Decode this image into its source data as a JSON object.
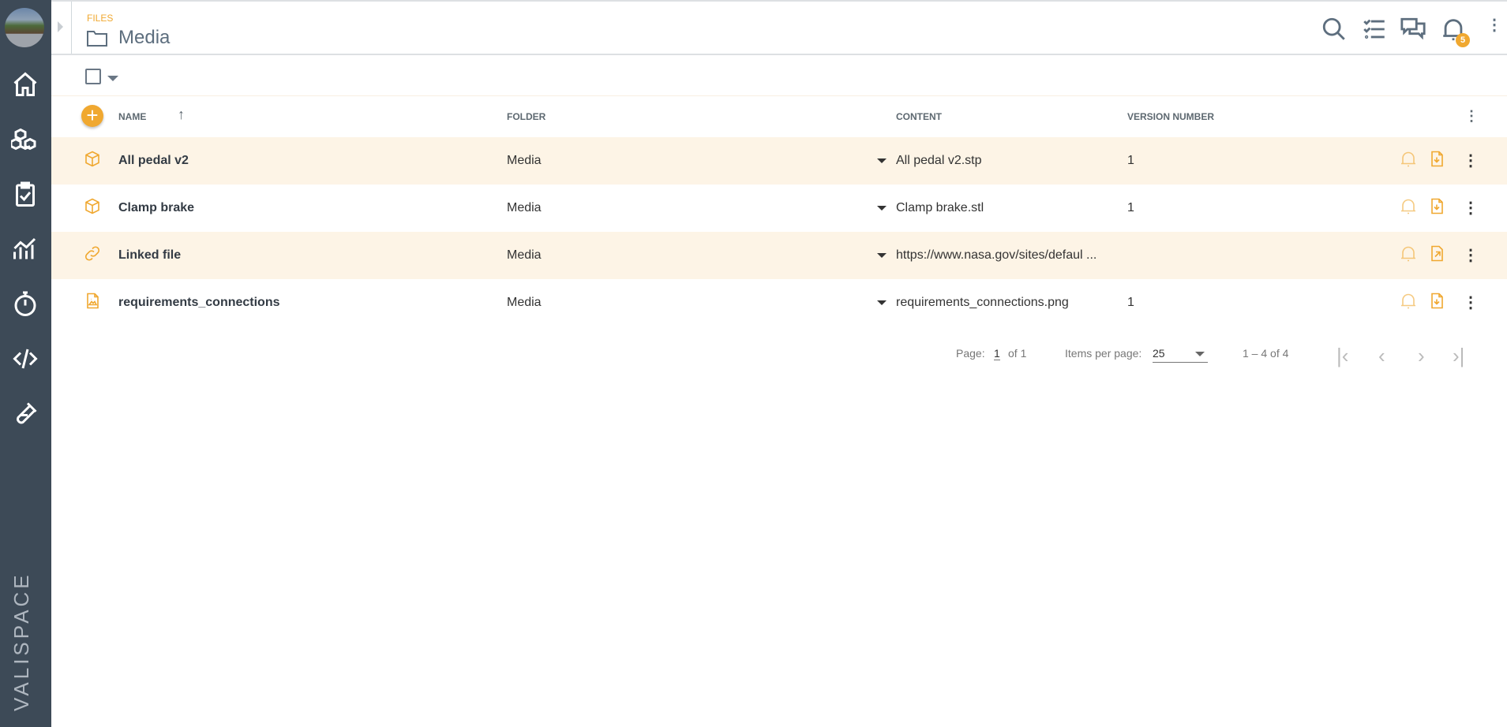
{
  "sidebar": {
    "brand": "VALISPACE",
    "items": [
      "home-icon",
      "components-icon",
      "requirements-icon",
      "analyses-icon",
      "timer-icon",
      "scripting-icon",
      "test-icon"
    ]
  },
  "header": {
    "breadcrumb": "FILES",
    "title": "Media",
    "notification_count": "5"
  },
  "table": {
    "columns": {
      "name": "NAME",
      "folder": "FOLDER",
      "content": "CONTENT",
      "version": "VERSION NUMBER"
    },
    "rows": [
      {
        "name": "All pedal v2",
        "folder": "Media",
        "content": "All pedal v2.stp",
        "version": "1",
        "type": "component"
      },
      {
        "name": "Clamp brake",
        "folder": "Media",
        "content": "Clamp brake.stl",
        "version": "1",
        "type": "component"
      },
      {
        "name": "Linked file",
        "folder": "Media",
        "content": "https://www.nasa.gov/sites/defaul ...",
        "version": "",
        "type": "link"
      },
      {
        "name": "requirements_connections",
        "folder": "Media",
        "content": "requirements_connections.png",
        "version": "1",
        "type": "image"
      }
    ]
  },
  "pagination": {
    "page_label": "Page:",
    "page": "1",
    "of": "of 1",
    "items_label": "Items per page:",
    "items_per_page": "25",
    "range": "1 – 4 of 4"
  },
  "colors": {
    "accent": "#f0a830",
    "sidebar": "#3d4a57",
    "row_highlight": "#fdf4e6"
  }
}
